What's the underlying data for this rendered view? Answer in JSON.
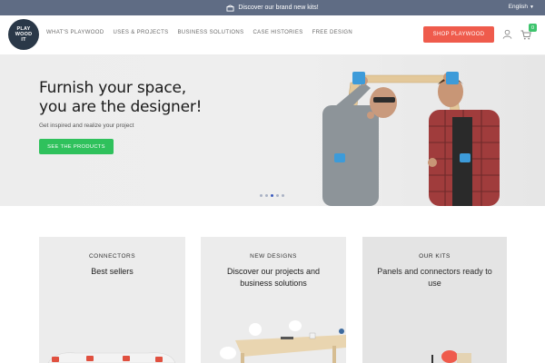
{
  "topbar": {
    "announcement": "Discover our brand new kits!",
    "language": "English"
  },
  "header": {
    "logo_text_lines": [
      "PLAY",
      "WOOD",
      "IT"
    ],
    "nav": [
      {
        "label": "WHAT'S PLAYWOOD"
      },
      {
        "label": "USES & PROJECTS"
      },
      {
        "label": "BUSINESS SOLUTIONS"
      },
      {
        "label": "CASE HISTORIES"
      },
      {
        "label": "FREE DESIGN"
      }
    ],
    "shop_button": "SHOP PLAYWOOD",
    "cart_count": "0"
  },
  "hero": {
    "title_line1": "Furnish your space,",
    "title_line2": "you are the designer!",
    "subtitle": "Get inspired and realize your project",
    "cta": "SEE THE PRODUCTS",
    "slides": 5,
    "active_slide": 2
  },
  "cards": [
    {
      "kicker": "CONNECTORS",
      "heading": "Best sellers"
    },
    {
      "kicker": "NEW DESIGNS",
      "heading": "Discover our projects and business solutions"
    },
    {
      "kicker": "OUR KITS",
      "heading": "Panels and connectors ready to use"
    }
  ],
  "colors": {
    "topbar": "#5f6c84",
    "shop_button": "#ef5b4c",
    "cta": "#2fc15c",
    "cart_badge": "#3ec46d",
    "connector_blue": "#3d9bd9"
  },
  "icons": [
    "kit-icon",
    "user-icon",
    "cart-icon",
    "chevron-down-icon"
  ]
}
